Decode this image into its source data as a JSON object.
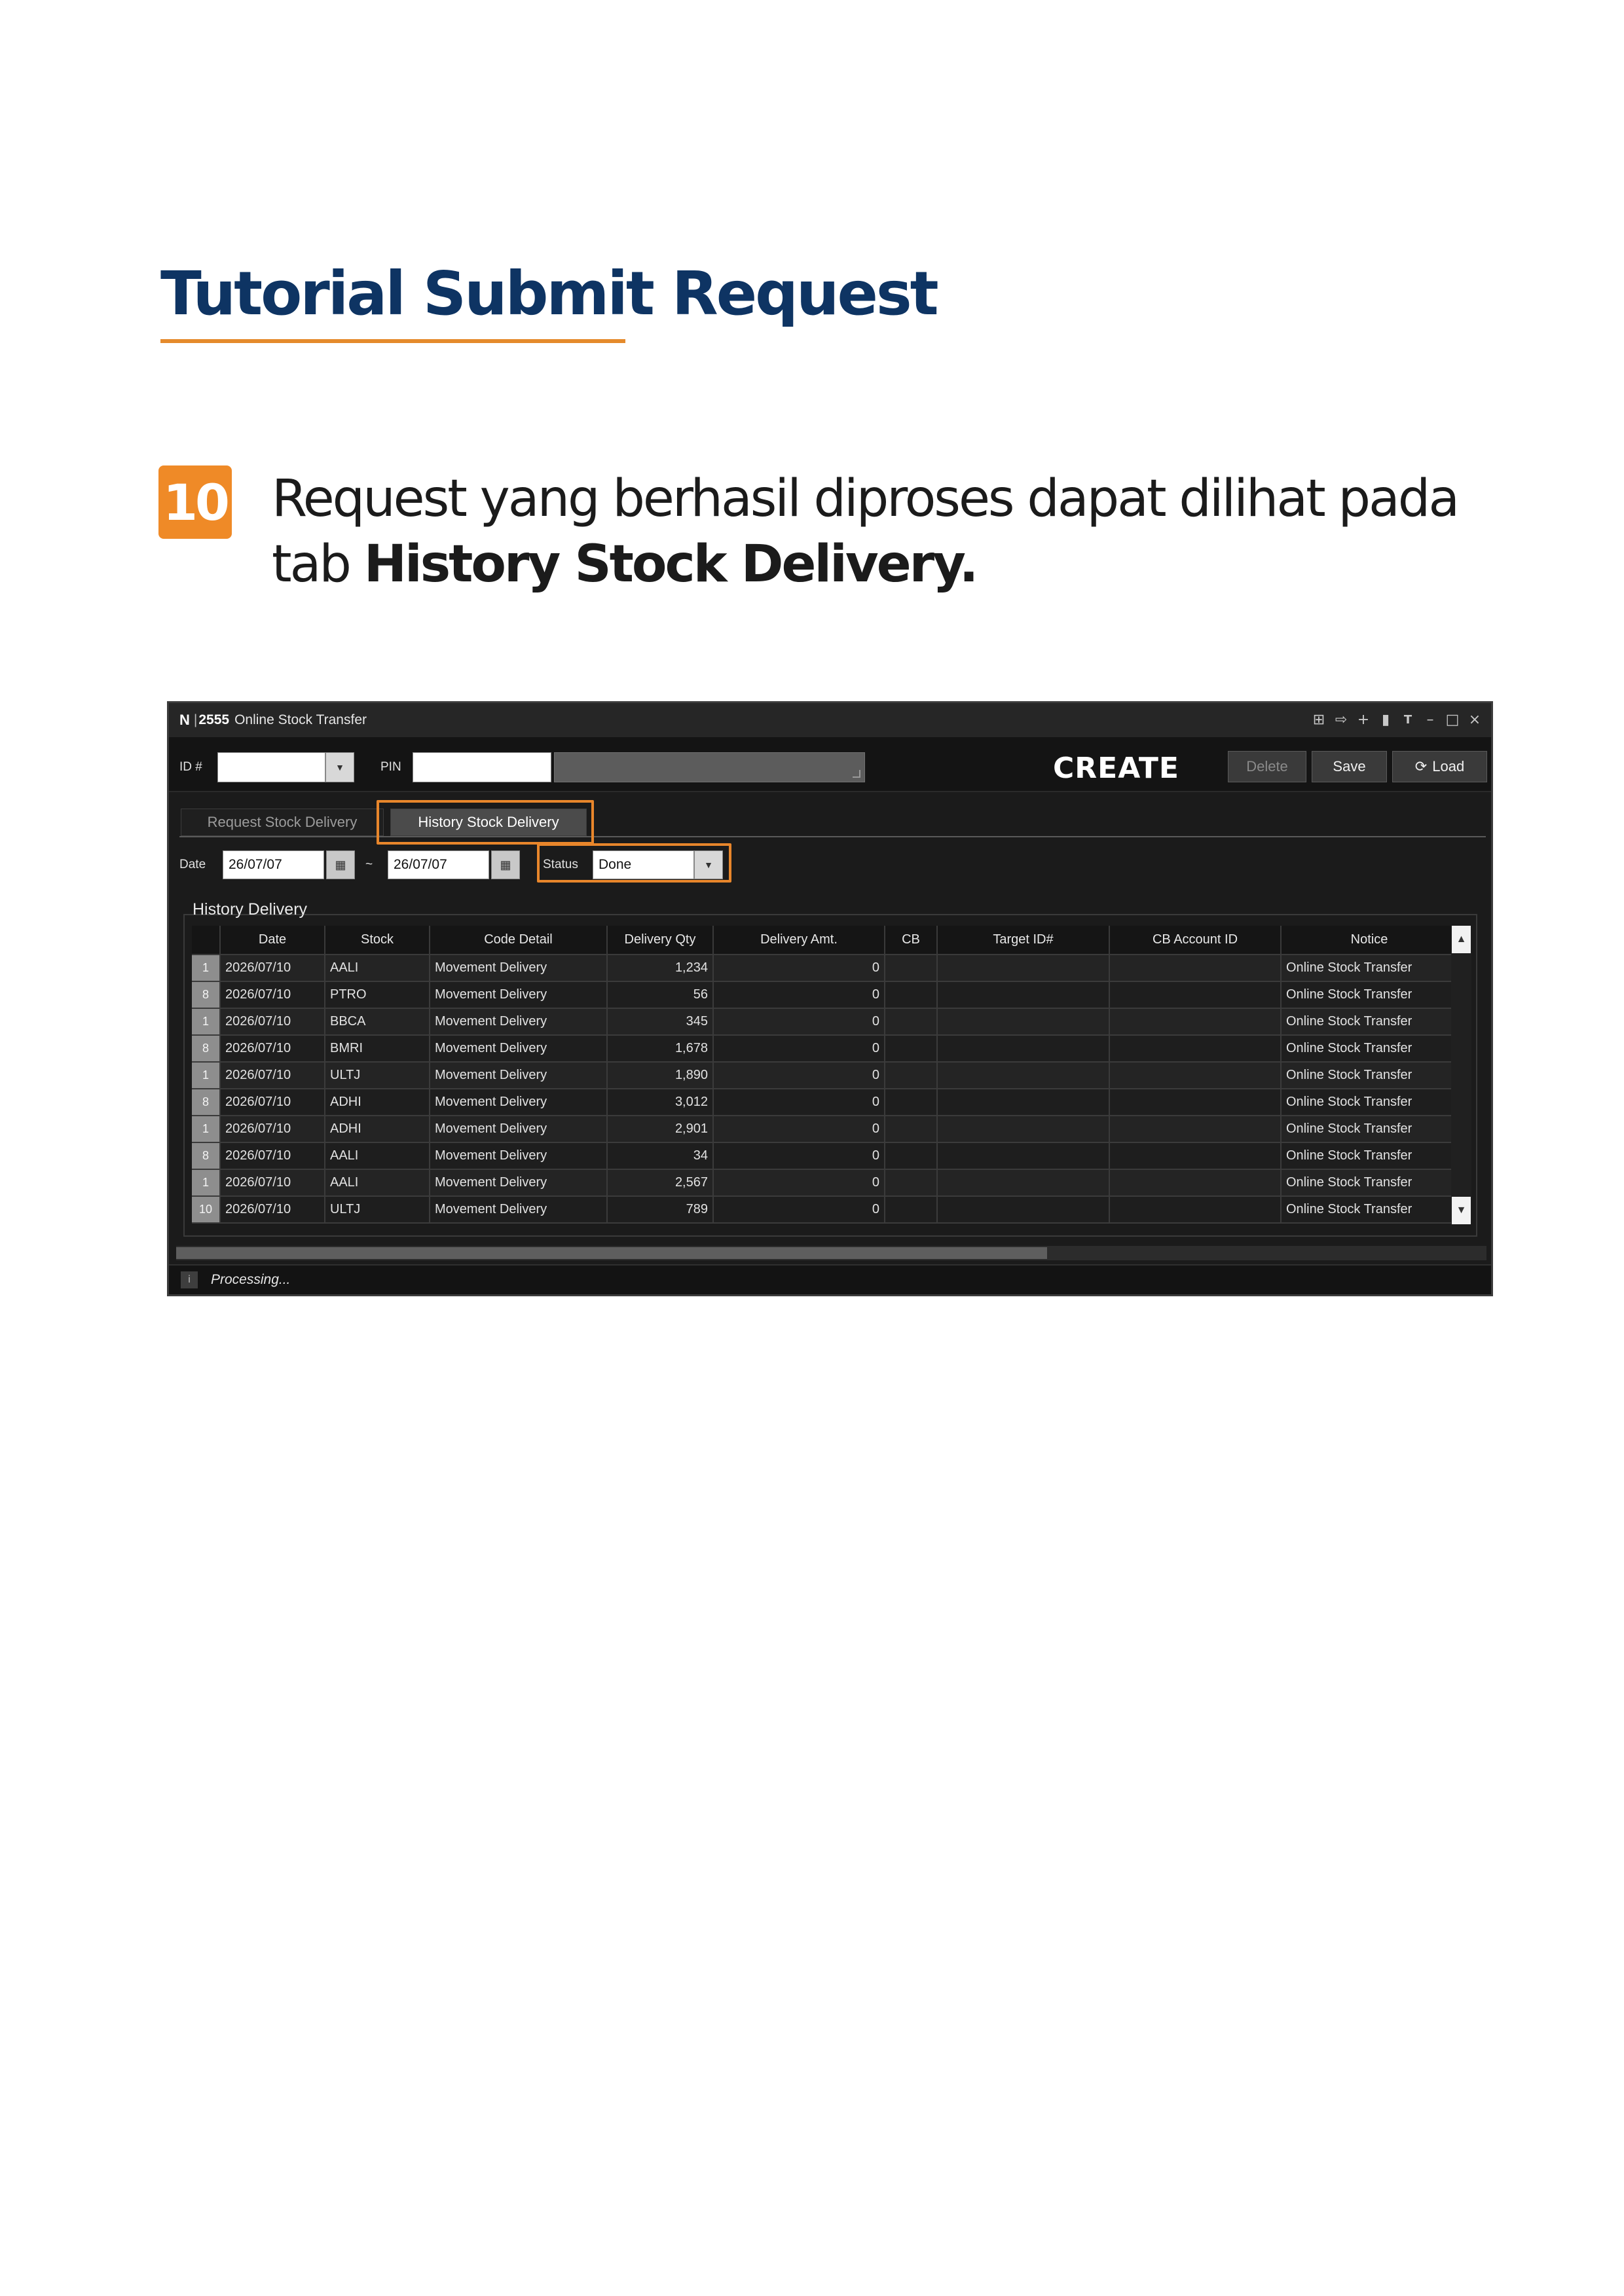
{
  "doc": {
    "title": "Tutorial Submit Request",
    "step_number": "10",
    "step_text_line1": "Request yang berhasil diproses dapat dilihat pada",
    "step_text_prefix": "tab ",
    "step_text_bold": "History Stock Delivery."
  },
  "colors": {
    "navy": "#0e3463",
    "orange": "#ef8a27",
    "window_bg": "#1b1b1b"
  },
  "window": {
    "logo": "N",
    "separator": "|",
    "code": "2555",
    "title": "Online Stock Transfer",
    "controls": [
      "grid-icon",
      "export-icon",
      "plus-icon",
      "trash-icon",
      "font-size-icon",
      "minimize-icon",
      "maximize-icon",
      "close-icon"
    ]
  },
  "toolbar": {
    "id_label": "ID #",
    "id_value": "",
    "pin_label": "PIN",
    "pin_value": "",
    "mode": "CREATE",
    "delete_label": "Delete",
    "save_label": "Save",
    "load_label": "Load"
  },
  "tabs": [
    {
      "label": "Request Stock Delivery",
      "active": false
    },
    {
      "label": "History Stock Delivery",
      "active": true
    }
  ],
  "filters": {
    "date_label": "Date",
    "date_from": "26/07/07",
    "range_sep": "~",
    "date_to": "26/07/07",
    "status_label": "Status",
    "status_value": "Done"
  },
  "history": {
    "title": "History Delivery",
    "columns": [
      "Date",
      "Stock",
      "Code Detail",
      "Delivery Qty",
      "Delivery Amt.",
      "CB",
      "Target ID#",
      "CB Account ID",
      "Notice"
    ],
    "rows": [
      [
        "1",
        "2026/07/10",
        "AALI",
        "Movement Delivery",
        "1,234",
        "0",
        "",
        "",
        "",
        "Online Stock Transfer"
      ],
      [
        "8",
        "2026/07/10",
        "PTRO",
        "Movement Delivery",
        "56",
        "0",
        "",
        "",
        "",
        "Online Stock Transfer"
      ],
      [
        "1",
        "2026/07/10",
        "BBCA",
        "Movement Delivery",
        "345",
        "0",
        "",
        "",
        "",
        "Online Stock Transfer"
      ],
      [
        "8",
        "2026/07/10",
        "BMRI",
        "Movement Delivery",
        "1,678",
        "0",
        "",
        "",
        "",
        "Online Stock Transfer"
      ],
      [
        "1",
        "2026/07/10",
        "ULTJ",
        "Movement Delivery",
        "1,890",
        "0",
        "",
        "",
        "",
        "Online Stock Transfer"
      ],
      [
        "8",
        "2026/07/10",
        "ADHI",
        "Movement Delivery",
        "3,012",
        "0",
        "",
        "",
        "",
        "Online Stock Transfer"
      ],
      [
        "1",
        "2026/07/10",
        "ADHI",
        "Movement Delivery",
        "2,901",
        "0",
        "",
        "",
        "",
        "Online Stock Transfer"
      ],
      [
        "8",
        "2026/07/10",
        "AALI",
        "Movement Delivery",
        "34",
        "0",
        "",
        "",
        "",
        "Online Stock Transfer"
      ],
      [
        "1",
        "2026/07/10",
        "AALI",
        "Movement Delivery",
        "2,567",
        "0",
        "",
        "",
        "",
        "Online Stock Transfer"
      ],
      [
        "10",
        "2026/07/10",
        "ULTJ",
        "Movement Delivery",
        "789",
        "0",
        "",
        "",
        "",
        "Online Stock Transfer"
      ]
    ]
  },
  "status_bar": {
    "icon": "info-icon",
    "text": "Processing..."
  }
}
